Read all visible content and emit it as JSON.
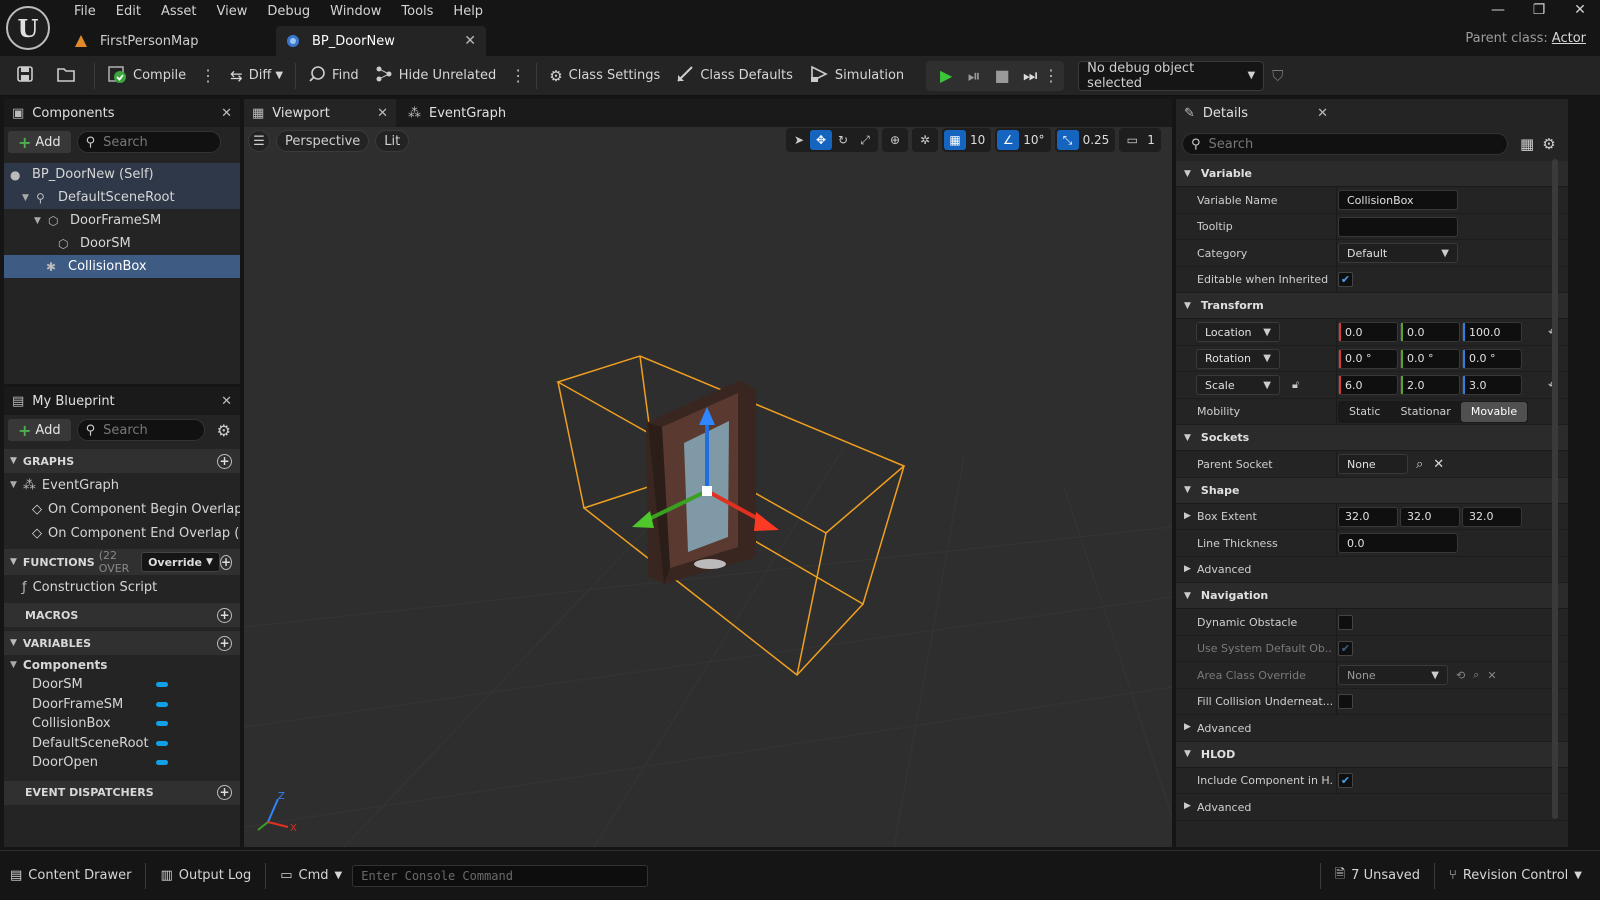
{
  "menu": [
    "File",
    "Edit",
    "Asset",
    "View",
    "Debug",
    "Window",
    "Tools",
    "Help"
  ],
  "tabs": [
    {
      "label": "FirstPersonMap"
    },
    {
      "label": "BP_DoorNew"
    }
  ],
  "parent_class": {
    "label": "Parent class:",
    "value": "Actor"
  },
  "toolbar": {
    "compile": "Compile",
    "diff": "Diff",
    "find": "Find",
    "hide_unrelated": "Hide Unrelated",
    "class_settings": "Class Settings",
    "class_defaults": "Class Defaults",
    "simulation": "Simulation",
    "debug_select": "No debug object selected"
  },
  "components": {
    "title": "Components",
    "add": "Add",
    "search_placeholder": "Search",
    "tree": [
      {
        "label": "BP_DoorNew (Self)"
      },
      {
        "label": "DefaultSceneRoot"
      },
      {
        "label": "DoorFrameSM"
      },
      {
        "label": "DoorSM"
      },
      {
        "label": "CollisionBox"
      }
    ]
  },
  "myblueprint": {
    "title": "My Blueprint",
    "add": "Add",
    "search_placeholder": "Search",
    "graphs_header": "GRAPHS",
    "event_graph": "EventGraph",
    "events": [
      "On Component Begin Overlap (Co",
      "On Component End Overlap (Colli"
    ],
    "functions_header": "FUNCTIONS",
    "functions_count": "(22 OVER",
    "override": "Override",
    "construction_script": "Construction Script",
    "macros_header": "MACROS",
    "variables_header": "VARIABLES",
    "components_group": "Components",
    "variables": [
      "DoorSM",
      "DoorFrameSM",
      "CollisionBox",
      "DefaultSceneRoot",
      "DoorOpen"
    ],
    "dispatchers_header": "EVENT DISPATCHERS"
  },
  "viewport": {
    "tab": "Viewport",
    "graph_tab": "EventGraph",
    "perspective": "Perspective",
    "lit": "Lit",
    "grid_snap": "10",
    "rot_snap": "10°",
    "scale_snap": "0.25",
    "camera_speed": "1"
  },
  "details": {
    "title": "Details",
    "search_placeholder": "Search",
    "variable_header": "Variable",
    "variable_name_label": "Variable Name",
    "variable_name_value": "CollisionBox",
    "tooltip_label": "Tooltip",
    "tooltip_value": "",
    "category_label": "Category",
    "category_value": "Default",
    "editable_label": "Editable when Inherited",
    "transform_header": "Transform",
    "location_label": "Location",
    "location": [
      "0.0",
      "0.0",
      "100.0"
    ],
    "rotation_label": "Rotation",
    "rotation": [
      "0.0 °",
      "0.0 °",
      "0.0 °"
    ],
    "scale_label": "Scale",
    "scale": [
      "6.0",
      "2.0",
      "3.0"
    ],
    "mobility_label": "Mobility",
    "mobility_options": [
      "Static",
      "Stationar",
      "Movable"
    ],
    "sockets_header": "Sockets",
    "parent_socket_label": "Parent Socket",
    "parent_socket_value": "None",
    "shape_header": "Shape",
    "box_extent_label": "Box Extent",
    "box_extent": [
      "32.0",
      "32.0",
      "32.0"
    ],
    "line_thickness_label": "Line Thickness",
    "line_thickness_value": "0.0",
    "advanced_label": "Advanced",
    "navigation_header": "Navigation",
    "dynamic_obstacle_label": "Dynamic Obstacle",
    "use_system_default_label": "Use System Default Ob...",
    "area_class_label": "Area Class Override",
    "area_class_value": "None",
    "fill_collision_label": "Fill Collision Underneat...",
    "hlod_header": "HLOD",
    "include_component_label": "Include Component in H..."
  },
  "statusbar": {
    "content_drawer": "Content Drawer",
    "output_log": "Output Log",
    "cmd": "Cmd",
    "console_placeholder": "Enter Console Command",
    "unsaved": "7 Unsaved",
    "revision_control": "Revision Control"
  },
  "colors": {
    "accent_blue": "#3d5b83",
    "selection_box": "#f0a020",
    "play_green": "#3cc43c"
  }
}
